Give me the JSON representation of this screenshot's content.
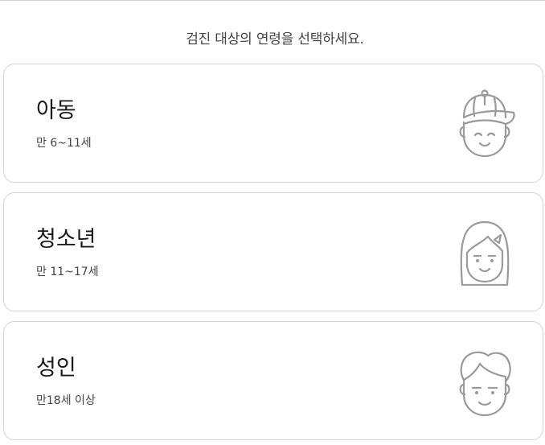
{
  "instruction": "검진 대상의 연령을 선택하세요.",
  "options": [
    {
      "title": "아동",
      "subtitle": "만 6~11세",
      "icon": "child-cap-icon"
    },
    {
      "title": "청소년",
      "subtitle": "만 11~17세",
      "icon": "teen-girl-icon"
    },
    {
      "title": "성인",
      "subtitle": "만18세 이상",
      "icon": "adult-man-icon"
    }
  ],
  "colors": {
    "border": "#d3d3d3",
    "icon": "#9a9a9a",
    "title": "#1a1a1a",
    "subtitle": "#444444"
  }
}
